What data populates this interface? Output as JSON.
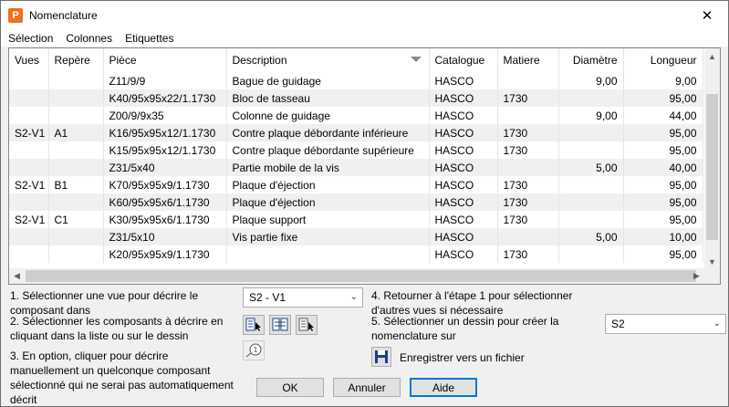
{
  "window": {
    "title": "Nomenclature",
    "icon": "P"
  },
  "menu": [
    "Sélection",
    "Colonnes",
    "Etiquettes"
  ],
  "table": {
    "columns": [
      "Vues",
      "Repère",
      "Pièce",
      "Description",
      "Catalogue",
      "Matiere",
      "Diamètre",
      "Longueur"
    ],
    "rows": [
      [
        "",
        "",
        "Z11/9/9",
        "Bague de guidage",
        "HASCO",
        "",
        "9,00",
        "9,00"
      ],
      [
        "",
        "",
        "K40/95x95x22/1.1730",
        "Bloc de tasseau",
        "HASCO",
        "1730",
        "",
        "95,00"
      ],
      [
        "",
        "",
        "Z00/9/9x35",
        "Colonne de guidage",
        "HASCO",
        "",
        "9,00",
        "44,00"
      ],
      [
        "S2-V1",
        "A1",
        "K16/95x95x12/1.1730",
        "Contre plaque débordante inférieure",
        "HASCO",
        "1730",
        "",
        "95,00"
      ],
      [
        "",
        "",
        "K15/95x95x12/1.1730",
        "Contre plaque débordante supérieure",
        "HASCO",
        "1730",
        "",
        "95,00"
      ],
      [
        "",
        "",
        "Z31/5x40",
        "Partie mobile de la vis",
        "HASCO",
        "",
        "5,00",
        "40,00"
      ],
      [
        "S2-V1",
        "B1",
        "K70/95x95x9/1.1730",
        "Plaque d'éjection",
        "HASCO",
        "1730",
        "",
        "95,00"
      ],
      [
        "",
        "",
        "K60/95x95x6/1.1730",
        "Plaque d'éjection",
        "HASCO",
        "1730",
        "",
        "95,00"
      ],
      [
        "S2-V1",
        "C1",
        "K30/95x95x6/1.1730",
        "Plaque support",
        "HASCO",
        "1730",
        "",
        "95,00"
      ],
      [
        "",
        "",
        "Z31/5x10",
        "Vis partie fixe",
        "HASCO",
        "",
        "5,00",
        "10,00"
      ],
      [
        "",
        "",
        "K20/95x95x9/1.1730",
        "",
        "HASCO",
        "1730",
        "",
        "95,00"
      ]
    ]
  },
  "steps": {
    "step1": "1. Sélectionner une vue pour décrire le composant dans",
    "step2": "2. Sélectionner les composants à décrire en cliquant dans la liste ou sur le dessin",
    "step3": "3. En option, cliquer pour décrire manuellement un quelconque composant sélectionné qui ne serai pas automatiquement décrit",
    "step4": "4. Retourner à l'étape 1 pour sélectionner d'autres vues si nécessaire",
    "step5": "5. Sélectionner un dessin pour créer la nomenclature sur"
  },
  "view_select": {
    "value": "S2 - V1"
  },
  "drawing_select": {
    "value": "S2"
  },
  "save_label": "Enregistrer vers un fichier",
  "buttons": {
    "ok": "OK",
    "cancel": "Annuler",
    "help": "Aide"
  },
  "icons": {
    "close": "close-icon",
    "select_list": "select-in-list-icon",
    "select_drawing": "select-in-drawing-icon",
    "deselect": "deselect-icon",
    "manual_describe": "balloon-callout-icon",
    "save": "floppy-disk-icon"
  },
  "colors": {
    "accent": "#0078d7",
    "app_icon": "#e8731f",
    "row_alt": "#f0f0f0"
  }
}
